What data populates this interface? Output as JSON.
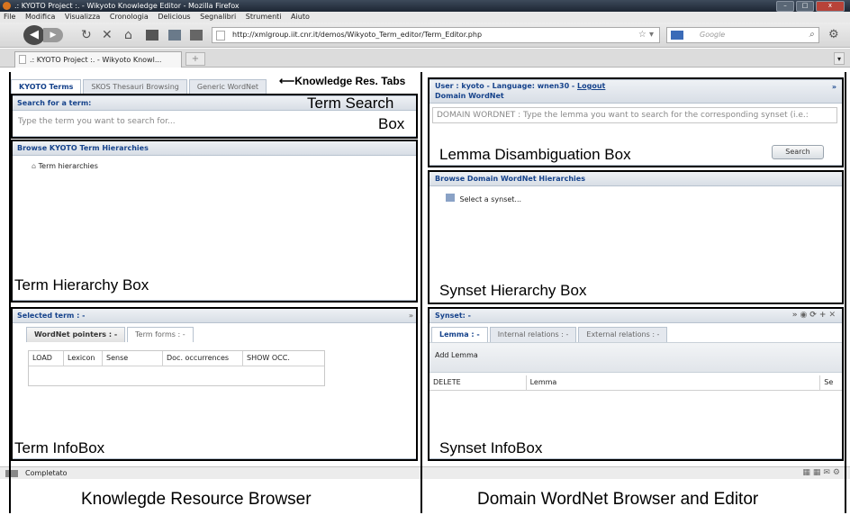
{
  "browser": {
    "window_title": ".: KYOTO Project :. - Wikyoto Knowledge Editor - Mozilla Firefox",
    "menu": [
      "File",
      "Modifica",
      "Visualizza",
      "Cronologia",
      "Delicious",
      "Segnalibri",
      "Strumenti",
      "Aiuto"
    ],
    "url": "http://xmlgroup.iit.cnr.it/demos/Wikyoto_Term_editor/Term_Editor.php",
    "search_placeholder": "Google",
    "tab_title": ".: KYOTO Project :. - Wikyoto Knowl...",
    "status": "Completato"
  },
  "left": {
    "tabs": [
      "KYOTO Terms",
      "SKOS Thesauri Browsing",
      "Generic WordNet"
    ],
    "search": {
      "header": "Search for a term:",
      "placeholder": "Type the term you want to search for..."
    },
    "hierarchy": {
      "header": "Browse KYOTO Term Hierarchies",
      "root": "Term hierarchies"
    },
    "infobox": {
      "header": "Selected term : -",
      "tabs": [
        "WordNet pointers : -",
        "Term forms : -"
      ],
      "columns": [
        "LOAD",
        "Lexicon",
        "Sense",
        "Doc. occurrences",
        "SHOW OCC."
      ]
    }
  },
  "right": {
    "user_line": "User : kyoto - Language: wnen30 - ",
    "logout": "Logout",
    "domain_title": "Domain WordNet",
    "lemma_placeholder": "DOMAIN WORDNET : Type the lemma you want to search for the corresponding synset (i.e.:",
    "search_button": "Search",
    "hierarchy": {
      "header": "Browse Domain WordNet Hierarchies",
      "root": "Select a synset..."
    },
    "synset": {
      "header": "Synset: -",
      "tabs": [
        "Lemma : -",
        "Internal relations : -",
        "External relations : -"
      ],
      "add_lemma": "Add Lemma",
      "columns": [
        "DELETE",
        "Lemma",
        "Se"
      ]
    }
  },
  "annotations": {
    "knowledge_tabs": "Knowledge Res. Tabs",
    "term_search_1": "Term Search",
    "term_search_2": "Box",
    "term_hierarchy": "Term Hierarchy Box",
    "term_infobox": "Term InfoBox",
    "lemma_box": "Lemma Disambiguation Box",
    "synset_hierarchy": "Synset Hierarchy Box",
    "synset_infobox": "Synset InfoBox",
    "left_caption": "Knowlegde Resource Browser",
    "right_caption": "Domain WordNet Browser and Editor"
  }
}
